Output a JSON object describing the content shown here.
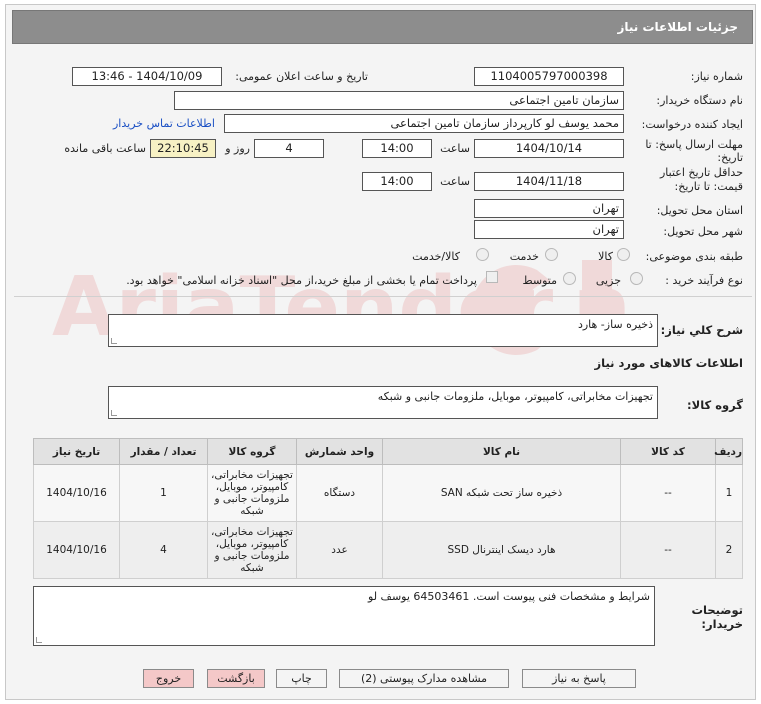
{
  "header": {
    "title": "جزئیات اطلاعات نیاز"
  },
  "fields": {
    "need_number_label": "شماره نیاز:",
    "need_number": "1104005797000398",
    "announce_label": "تاریخ و ساعت اعلان عمومی:",
    "announce_value": "1404/10/09 - 13:46",
    "buyer_org_label": "نام دستگاه خریدار:",
    "buyer_org": "سازمان تامین اجتماعی",
    "creator_label": "ایجاد کننده درخواست:",
    "creator": "محمد یوسف لو کارپرداز سازمان تامین اجتماعی",
    "contact_link": "اطلاعات تماس خریدار",
    "deadline_label_1": "مهلت ارسال پاسخ: تا",
    "deadline_label_2": "تاریخ:",
    "deadline_date": "1404/10/14",
    "time_label": "ساعت",
    "deadline_time": "14:00",
    "days_value": "4",
    "days_label": "روز و",
    "remaining_time": "22:10:45",
    "remaining_label": "ساعت باقی مانده",
    "validity_label_1": "حداقل تاریخ اعتبار",
    "validity_label_2": "قیمت: تا تاریخ:",
    "validity_date": "1404/11/18",
    "validity_time": "14:00",
    "province_label": "استان محل تحویل:",
    "province": "تهران",
    "city_label": "شهر محل تحویل:",
    "city": "تهران",
    "category_label": "طبقه بندی موضوعی:",
    "category_options": [
      "کالا",
      "خدمت",
      "کالا/خدمت"
    ],
    "process_label": "نوع فرآیند خرید :",
    "process_options": [
      "جزیی",
      "متوسط"
    ],
    "payment_note": "پرداخت تمام یا بخشی از مبلغ خرید،از محل \"اسناد خزانه اسلامی\" خواهد بود."
  },
  "summary": {
    "label": "شرح کلي نياز:",
    "value": "ذخیره ساز- هارد"
  },
  "goods": {
    "section_title": "اطلاعات کالاهای مورد نیاز",
    "group_label": "گروه کالا:",
    "group_value": "تجهیزات مخابراتی، کامپیوتر، موبایل، ملزومات جانبی و شبکه"
  },
  "table": {
    "headers": [
      "ردیف",
      "کد کالا",
      "نام کالا",
      "واحد شمارش",
      "گروه کالا",
      "تعداد / مقدار",
      "تاریخ نیاز"
    ],
    "rows": [
      [
        "1",
        "--",
        "ذخیره ساز تحت شبکه SAN",
        "دستگاه",
        "تجهیزات مخابراتی، کامپیوتر، موبایل، ملزومات جانبی و شبکه",
        "1",
        "1404/10/16"
      ],
      [
        "2",
        "--",
        "هارد دیسک اینترنال SSD",
        "عدد",
        "تجهیزات مخابراتی، کامپیوتر، موبایل، ملزومات جانبی و شبکه",
        "4",
        "1404/10/16"
      ]
    ]
  },
  "notes": {
    "label_1": "توضیحات",
    "label_2": "خریدار:",
    "value": "شرایط و مشخصات فنی پیوست است. 64503461 یوسف لو"
  },
  "buttons": {
    "reply": "پاسخ به نیاز",
    "attachments": "مشاهده مدارک پیوستی (2)",
    "print": "چاپ",
    "back": "بازگشت",
    "exit": "خروج"
  },
  "watermark": {
    "text": "AriaTender.net"
  },
  "colors": {
    "header_bg": "#8d8d8d",
    "link": "#1a4fc4",
    "remaining_bg": "#f7f1c4",
    "danger_btn": "#f4c8c8"
  }
}
